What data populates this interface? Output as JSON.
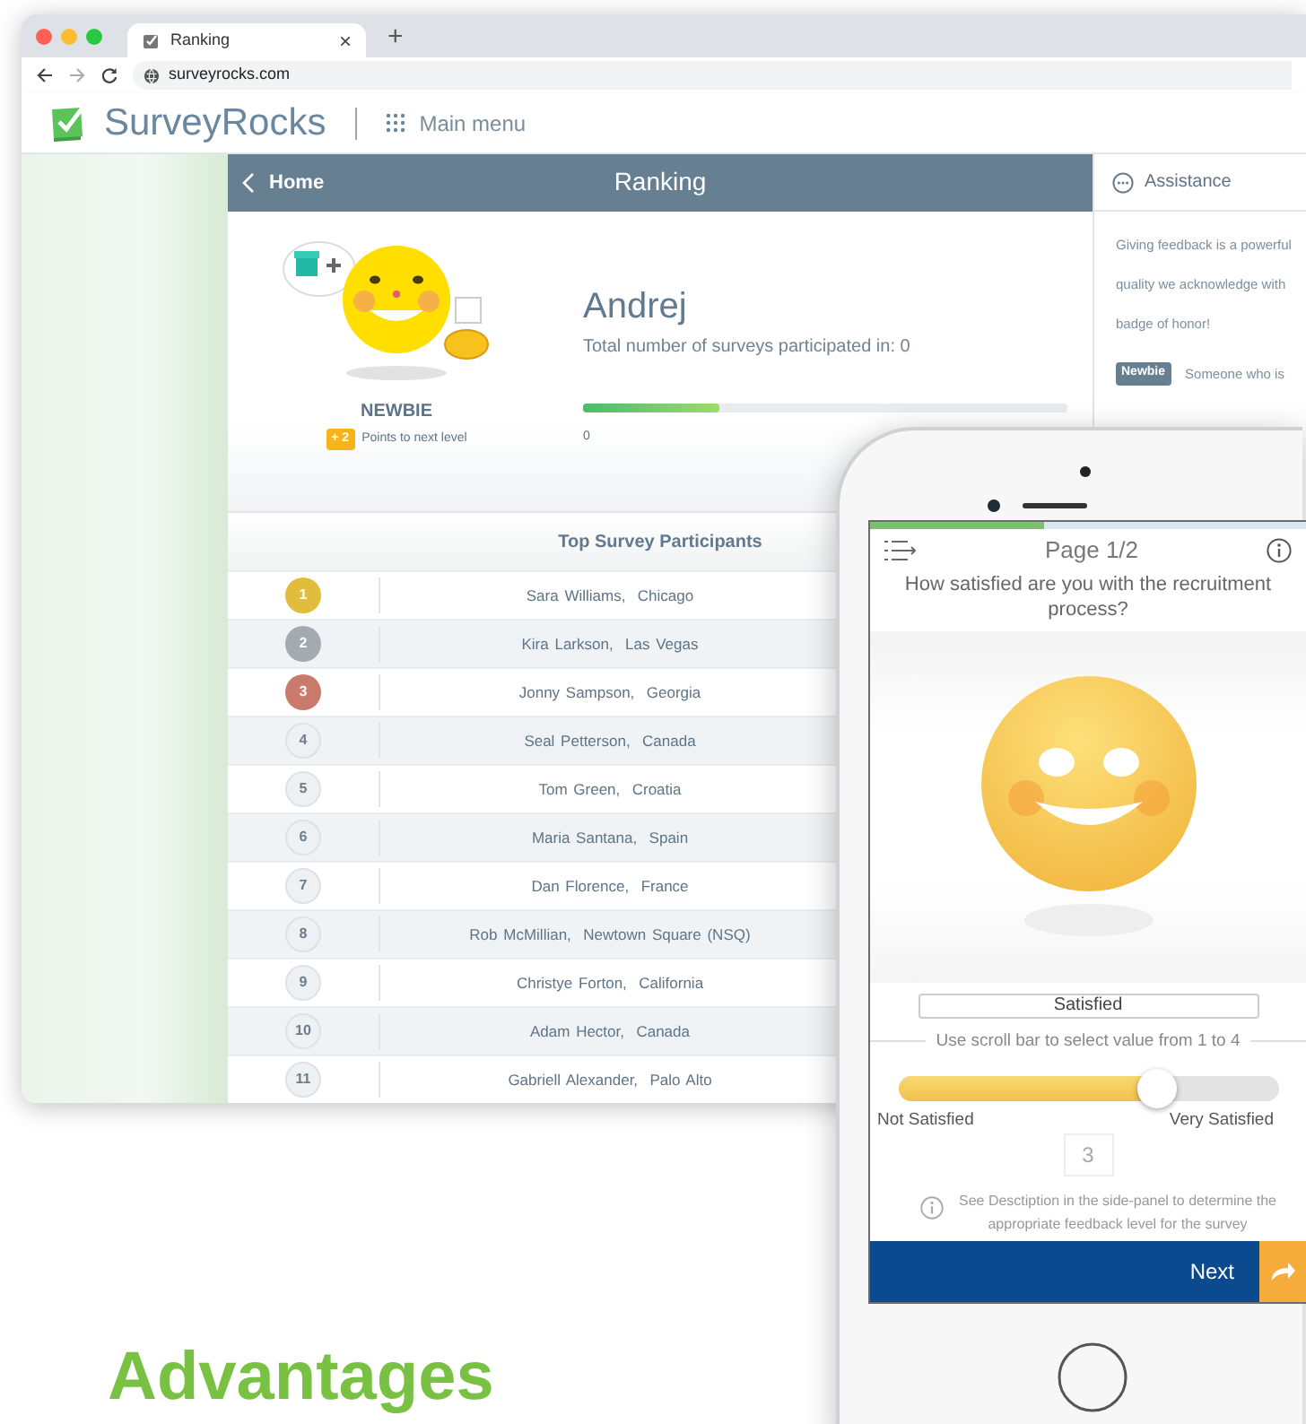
{
  "browser": {
    "tab_title": "Ranking",
    "close": "×",
    "new_tab": "+",
    "address": "surveyrocks.com"
  },
  "app": {
    "brand": "SurveyRocks",
    "menu": "Main menu"
  },
  "ranking_bar": {
    "back": "Home",
    "title": "Ranking"
  },
  "profile": {
    "name": "Andrej",
    "surveys": "Total number of surveys participated in: 0",
    "progress": {
      "level": 0.28,
      "label": "0"
    },
    "rank": "NEWBIE",
    "points_badge": "+ 2",
    "points_text": "Points to next level"
  },
  "participants": {
    "heading": "Top Survey Participants",
    "rows": [
      {
        "rank": "1",
        "name": "Sara Williams,  Chicago",
        "kind": "medal",
        "color": "#e2bd3c"
      },
      {
        "rank": "2",
        "name": "Kira Larkson,  Las Vegas",
        "kind": "medal",
        "color": "#a3aab1"
      },
      {
        "rank": "3",
        "name": "Jonny Sampson,  Georgia",
        "kind": "medal",
        "color": "#c97a6c"
      },
      {
        "rank": "4",
        "name": "Seal Petterson,  Canada",
        "kind": "plain",
        "color": "#eef1f4"
      },
      {
        "rank": "5",
        "name": "Tom Green,  Croatia",
        "kind": "plain",
        "color": "#eef1f4"
      },
      {
        "rank": "6",
        "name": "Maria Santana,  Spain",
        "kind": "plain",
        "color": "#eef1f4"
      },
      {
        "rank": "7",
        "name": "Dan Florence,  France",
        "kind": "plain",
        "color": "#eef1f4"
      },
      {
        "rank": "8",
        "name": "Rob McMillian,  Newtown Square (NSQ)",
        "kind": "plain",
        "color": "#eef1f4"
      },
      {
        "rank": "9",
        "name": "Christye Forton,  California",
        "kind": "plain",
        "color": "#eef1f4"
      },
      {
        "rank": "10",
        "name": "Adam Hector,  Canada",
        "kind": "plain",
        "color": "#eef1f4"
      },
      {
        "rank": "11",
        "name": "Gabriell Alexander,  Palo Alto",
        "kind": "plain",
        "color": "#eef1f4"
      }
    ]
  },
  "assistance": {
    "title": "Assistance",
    "lines": [
      "Giving feedback is a powerful",
      "quality we acknowledge with",
      "badge of honor!"
    ],
    "tag": "Newbie",
    "tag_text": "Someone who is"
  },
  "phone": {
    "progress": {
      "level": 0.4
    },
    "page": "Page 1/2",
    "question": "How satisfied are you with the recruitment process?",
    "answer": "Satisfied",
    "hint": "Use scroll bar to select value from 1 to 4",
    "slider": {
      "level": 0.68
    },
    "min_label": "Not Satisfied",
    "max_label": "Very Satisfied",
    "value": "3",
    "note": "See Desctiption in the side-panel to determine the appropriate feedback level for the survey",
    "next": "Next"
  },
  "footer_heading": "Advantages"
}
